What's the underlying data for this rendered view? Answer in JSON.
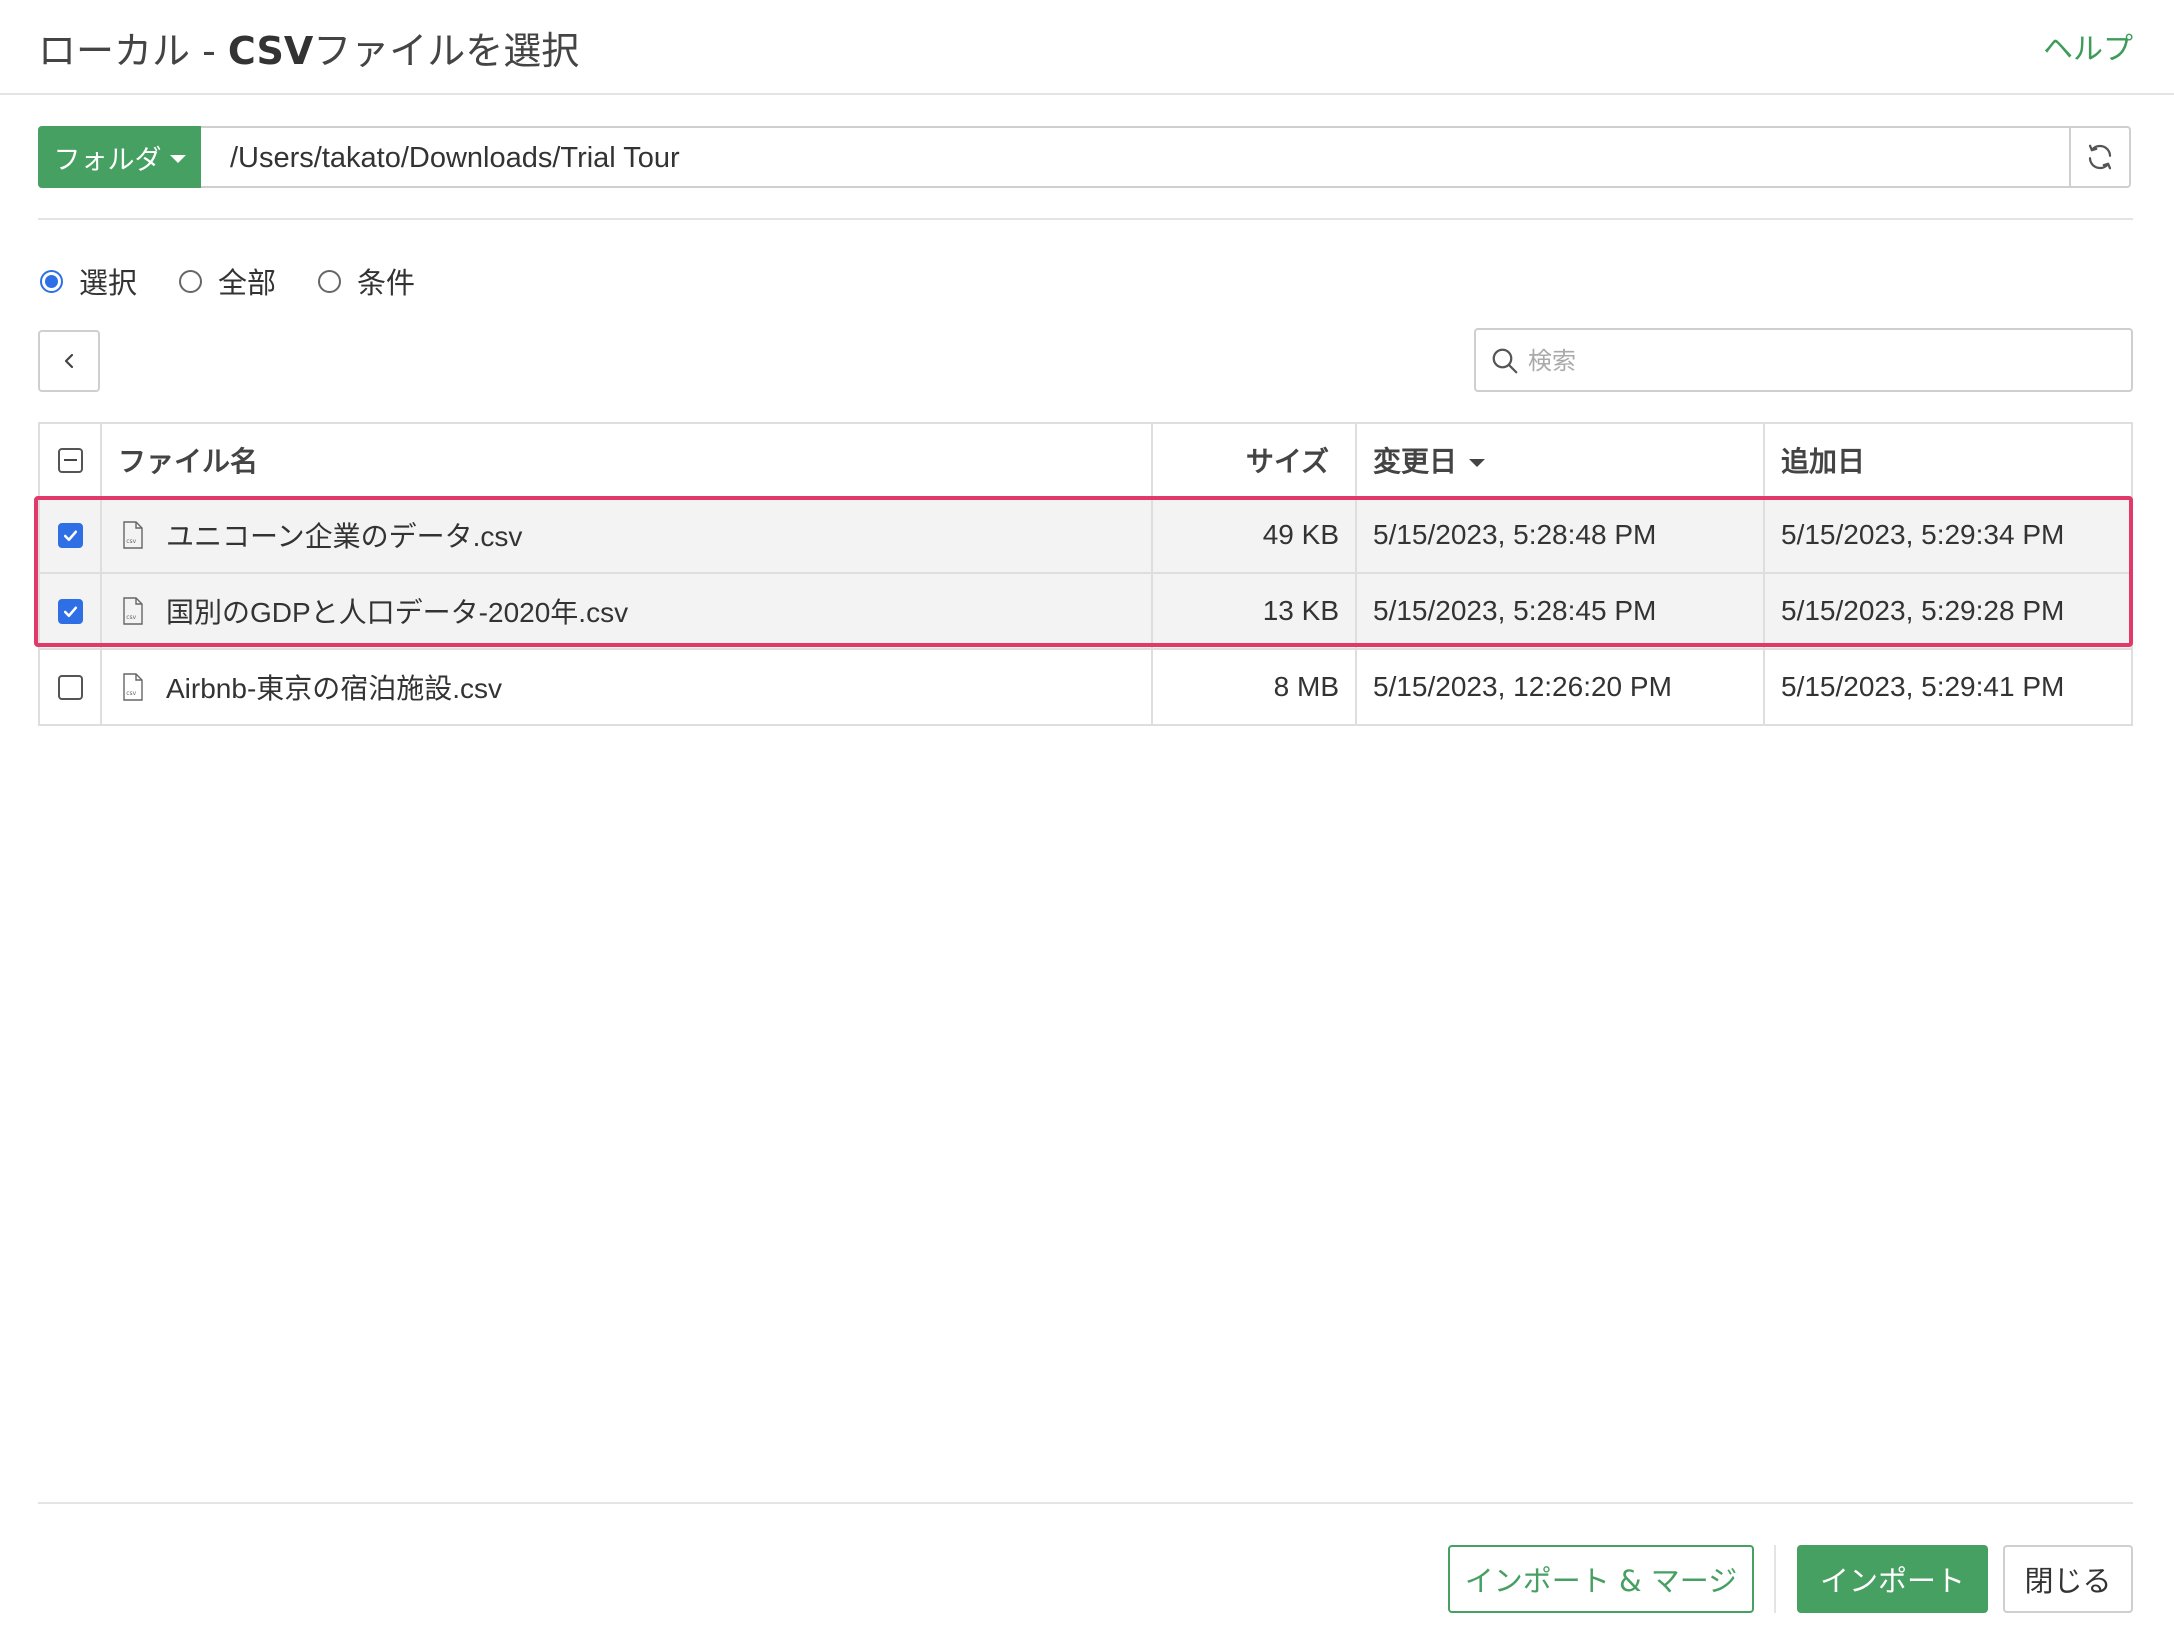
{
  "dialog": {
    "title_prefix": "ローカル - ",
    "title_bold": "CSV",
    "title_suffix": "ファイルを選択",
    "help": "ヘルプ"
  },
  "pathbar": {
    "folder_label": "フォルダ",
    "path": "/Users/takato/Downloads/Trial Tour"
  },
  "mode_options": [
    {
      "label": "選択",
      "selected": true
    },
    {
      "label": "全部",
      "selected": false
    },
    {
      "label": "条件",
      "selected": false
    }
  ],
  "search": {
    "placeholder": "検索",
    "value": ""
  },
  "table": {
    "headers": {
      "name": "ファイル名",
      "size": "サイズ",
      "modified": "変更日",
      "added": "追加日"
    },
    "sort_column": "modified",
    "rows": [
      {
        "name": "ユニコーン企業のデータ.csv",
        "size": "49 KB",
        "modified": "5/15/2023, 5:28:48 PM",
        "added": "5/15/2023, 5:29:34 PM",
        "checked": true
      },
      {
        "name": "国別のGDPと人口データ-2020年.csv",
        "size": "13 KB",
        "modified": "5/15/2023, 5:28:45 PM",
        "added": "5/15/2023, 5:29:28 PM",
        "checked": true
      },
      {
        "name": "Airbnb-東京の宿泊施設.csv",
        "size": "8 MB",
        "modified": "5/15/2023, 12:26:20 PM",
        "added": "5/15/2023, 5:29:41 PM",
        "checked": false
      }
    ]
  },
  "footer": {
    "import_merge": "インポート & マージ",
    "import": "インポート",
    "close": "閉じる"
  },
  "colors": {
    "accent_green": "#46a062",
    "check_blue": "#2f6fe6",
    "highlight": "#e0396a"
  }
}
